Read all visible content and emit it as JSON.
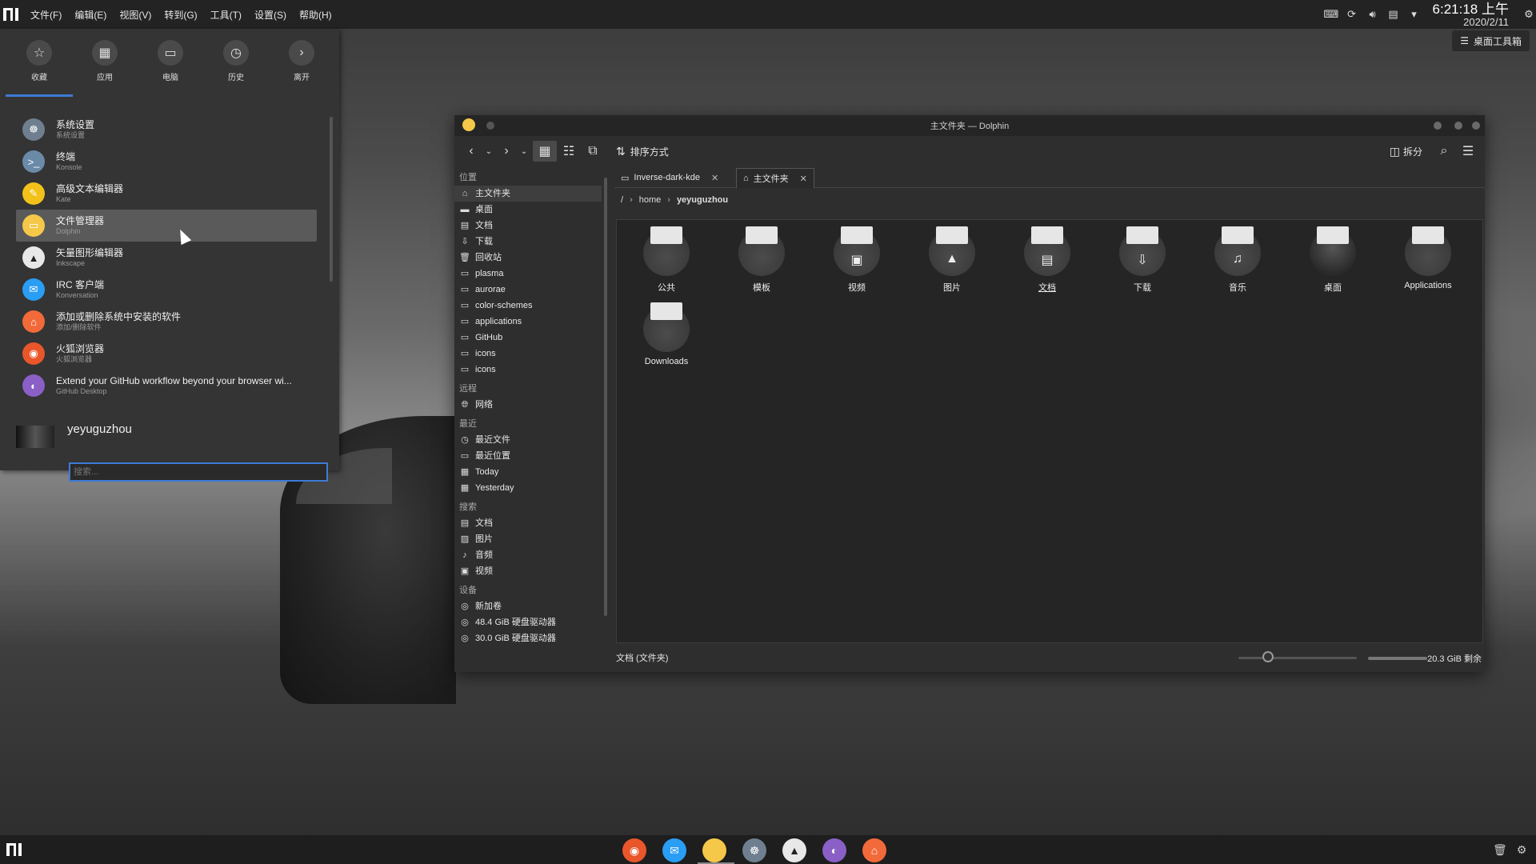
{
  "menubar": {
    "items": [
      "文件(F)",
      "编辑(E)",
      "视图(V)",
      "转到(G)",
      "工具(T)",
      "设置(S)",
      "帮助(H)"
    ],
    "clock_time": "6:21:18 上午",
    "clock_date": "2020/2/11",
    "desktop_toolbox": "桌面工具箱"
  },
  "launcher": {
    "tabs": [
      "收藏",
      "应用",
      "电脑",
      "历史",
      "离开"
    ],
    "apps": [
      {
        "name": "系统设置",
        "sub": "系统设置",
        "color": "#6f7f8f"
      },
      {
        "name": "终端",
        "sub": "Konsole",
        "color": "#6b8aa8"
      },
      {
        "name": "高级文本编辑器",
        "sub": "Kate",
        "color": "#f2c21b"
      },
      {
        "name": "文件管理器",
        "sub": "Dolphin",
        "color": "#f5c84a"
      },
      {
        "name": "矢量图形编辑器",
        "sub": "Inkscape",
        "color": "#2a2a2a"
      },
      {
        "name": "IRC 客户端",
        "sub": "Konversation",
        "color": "#2a9df4"
      },
      {
        "name": "添加或删除系统中安装的软件",
        "sub": "添加/删除软件",
        "color": "#f26a3a"
      },
      {
        "name": "火狐浏览器",
        "sub": "火狐浏览器",
        "color": "#e8562a"
      },
      {
        "name": "Extend your GitHub workflow beyond your browser wi...",
        "sub": "GitHub Desktop",
        "color": "#8a5fc6"
      }
    ],
    "username": "yeyuguzhou",
    "search_placeholder": "搜索..."
  },
  "dolphin": {
    "title": "主文件夹 — Dolphin",
    "sort_label": "排序方式",
    "split_label": "拆分",
    "places": {
      "header_location": "位置",
      "location": [
        "主文件夹",
        "桌面",
        "文档",
        "下载",
        "回收站",
        "plasma",
        "aurorae",
        "color-schemes",
        "applications",
        "GitHub",
        "icons",
        "icons"
      ],
      "header_remote": "远程",
      "remote": [
        "网络"
      ],
      "header_recent": "最近",
      "recent": [
        "最近文件",
        "最近位置",
        "Today",
        "Yesterday"
      ],
      "header_search": "搜索",
      "search": [
        "文档",
        "图片",
        "音频",
        "视频"
      ],
      "header_devices": "设备",
      "devices": [
        "新加卷",
        "48.4 GiB 硬盘驱动器",
        "30.0 GiB 硬盘驱动器"
      ]
    },
    "tabs": [
      "Inverse-dark-kde",
      "主文件夹"
    ],
    "breadcrumb": {
      "root": "/",
      "home": "home",
      "current": "yeyuguzhou"
    },
    "files": [
      {
        "label": "公共",
        "icon": "share"
      },
      {
        "label": "模板",
        "icon": "template"
      },
      {
        "label": "视频",
        "icon": "video"
      },
      {
        "label": "图片",
        "icon": "picture"
      },
      {
        "label": "文档",
        "icon": "document"
      },
      {
        "label": "下载",
        "icon": "download"
      },
      {
        "label": "音乐",
        "icon": "music"
      },
      {
        "label": "桌面",
        "icon": "desktop"
      },
      {
        "label": "Applications",
        "icon": "folder"
      },
      {
        "label": "Downloads",
        "icon": "folder"
      }
    ],
    "status_text": "文档 (文件夹)",
    "free_space": "20.3 GiB 剩余",
    "zoom_fraction": 0.2,
    "space_used_fraction": 0.5
  },
  "taskbar": {
    "apps": [
      {
        "name": "firefox-icon",
        "color": "#e8562a"
      },
      {
        "name": "konversation-icon",
        "color": "#2a9df4"
      },
      {
        "name": "dolphin-icon",
        "color": "#f5c84a"
      },
      {
        "name": "system-settings-icon",
        "color": "#6f7f8f"
      },
      {
        "name": "inkscape-icon",
        "color": "#2a2a2a"
      },
      {
        "name": "github-desktop-icon",
        "color": "#8a5fc6"
      },
      {
        "name": "discover-icon",
        "color": "#f26a3a"
      }
    ]
  }
}
